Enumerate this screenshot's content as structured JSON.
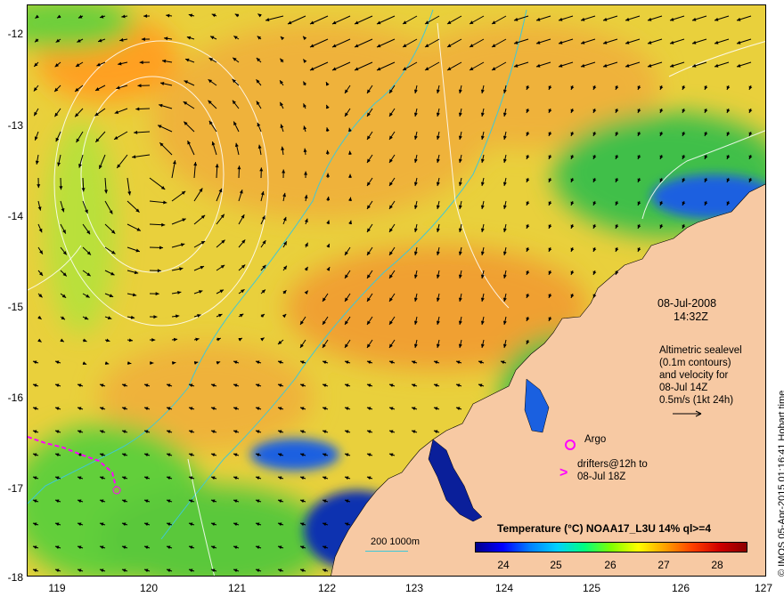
{
  "axes": {
    "y_ticks": [
      "-12",
      "-13",
      "-14",
      "-15",
      "-16",
      "-17",
      "-18"
    ],
    "x_ticks": [
      "119",
      "120",
      "121",
      "122",
      "123",
      "124",
      "125",
      "126",
      "127"
    ]
  },
  "annotations": {
    "date": "08-Jul-2008",
    "time": "14:32Z",
    "altimetry_lines": [
      "Altimetric sealevel",
      "(0.1m contours)",
      "and velocity for",
      "08-Jul 14Z"
    ],
    "velocity_scale": "0.5m/s (1kt 24h)",
    "argo_label": "Argo",
    "drifters_lines": [
      "drifters@12h to",
      "08-Jul 18Z"
    ],
    "depth_legend": "200  1000m",
    "side_text": "© IMOS 05-Apr-2015 01:16:41 Hobart time"
  },
  "colorbar": {
    "title": "Temperature (°C) NOAA17_L3U 14% ql>=4",
    "ticks": [
      "24",
      "25",
      "26",
      "27",
      "28"
    ],
    "colors": [
      "#00008b",
      "#0000ff",
      "#0080ff",
      "#00d0ff",
      "#00ff80",
      "#80ff00",
      "#ffff00",
      "#ffa000",
      "#ff4000",
      "#d00000",
      "#8b0000"
    ]
  },
  "colors": {
    "land": "#f7c9a3",
    "ocean_warm": "#f2b23a",
    "ocean_mid": "#e6d63a",
    "ocean_cool": "#3fbf4a",
    "ocean_cold": "#0a1f9a",
    "isobath": "#3ec8d8",
    "drifter": "#ff00ff"
  }
}
